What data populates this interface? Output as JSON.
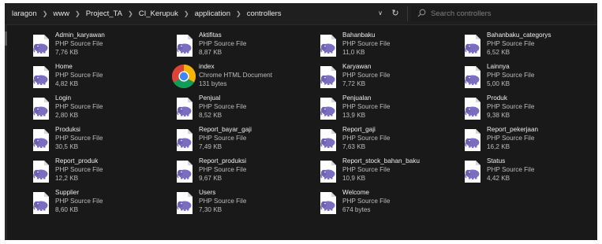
{
  "address": {
    "crumbs": [
      "laragon",
      "www",
      "Project_TA",
      "CI_Kerupuk",
      "application",
      "controllers"
    ]
  },
  "search": {
    "placeholder": "Search controllers"
  },
  "files": [
    {
      "name": "Admin_karyawan",
      "type": "PHP Source File",
      "size": "7,76 KB",
      "icon": "php-file-icon"
    },
    {
      "name": "Aktifitas",
      "type": "PHP Source File",
      "size": "8,87 KB",
      "icon": "php-file-icon"
    },
    {
      "name": "Bahanbaku",
      "type": "PHP Source File",
      "size": "11,0 KB",
      "icon": "php-file-icon"
    },
    {
      "name": "Bahanbaku_categorys",
      "type": "PHP Source File",
      "size": "6,52 KB",
      "icon": "php-file-icon"
    },
    {
      "name": "Home",
      "type": "PHP Source File",
      "size": "4,82 KB",
      "icon": "php-file-icon"
    },
    {
      "name": "index",
      "type": "Chrome HTML Document",
      "size": "131 bytes",
      "icon": "chrome-icon"
    },
    {
      "name": "Karyawan",
      "type": "PHP Source File",
      "size": "7,72 KB",
      "icon": "php-file-icon"
    },
    {
      "name": "Lainnya",
      "type": "PHP Source File",
      "size": "5,00 KB",
      "icon": "php-file-icon"
    },
    {
      "name": "Login",
      "type": "PHP Source File",
      "size": "2,80 KB",
      "icon": "php-file-icon"
    },
    {
      "name": "Penjual",
      "type": "PHP Source File",
      "size": "8,52 KB",
      "icon": "php-file-icon"
    },
    {
      "name": "Penjualan",
      "type": "PHP Source File",
      "size": "13,9 KB",
      "icon": "php-file-icon"
    },
    {
      "name": "Produk",
      "type": "PHP Source File",
      "size": "9,38 KB",
      "icon": "php-file-icon"
    },
    {
      "name": "Produksi",
      "type": "PHP Source File",
      "size": "30,5 KB",
      "icon": "php-file-icon"
    },
    {
      "name": "Report_bayar_gaji",
      "type": "PHP Source File",
      "size": "7,49 KB",
      "icon": "php-file-icon"
    },
    {
      "name": "Report_gaji",
      "type": "PHP Source File",
      "size": "7,63 KB",
      "icon": "php-file-icon"
    },
    {
      "name": "Report_pekerjaan",
      "type": "PHP Source File",
      "size": "16,2 KB",
      "icon": "php-file-icon"
    },
    {
      "name": "Report_produk",
      "type": "PHP Source File",
      "size": "12,2 KB",
      "icon": "php-file-icon"
    },
    {
      "name": "Report_produksi",
      "type": "PHP Source File",
      "size": "9,67 KB",
      "icon": "php-file-icon"
    },
    {
      "name": "Report_stock_bahan_baku",
      "type": "PHP Source File",
      "size": "10,9 KB",
      "icon": "php-file-icon"
    },
    {
      "name": "Status",
      "type": "PHP Source File",
      "size": "4,42 KB",
      "icon": "php-file-icon"
    },
    {
      "name": "Supplier",
      "type": "PHP Source File",
      "size": "8,60 KB",
      "icon": "php-file-icon"
    },
    {
      "name": "Users",
      "type": "PHP Source File",
      "size": "7,30 KB",
      "icon": "php-file-icon"
    },
    {
      "name": "Welcome",
      "type": "PHP Source File",
      "size": "674 bytes",
      "icon": "php-file-icon"
    }
  ]
}
